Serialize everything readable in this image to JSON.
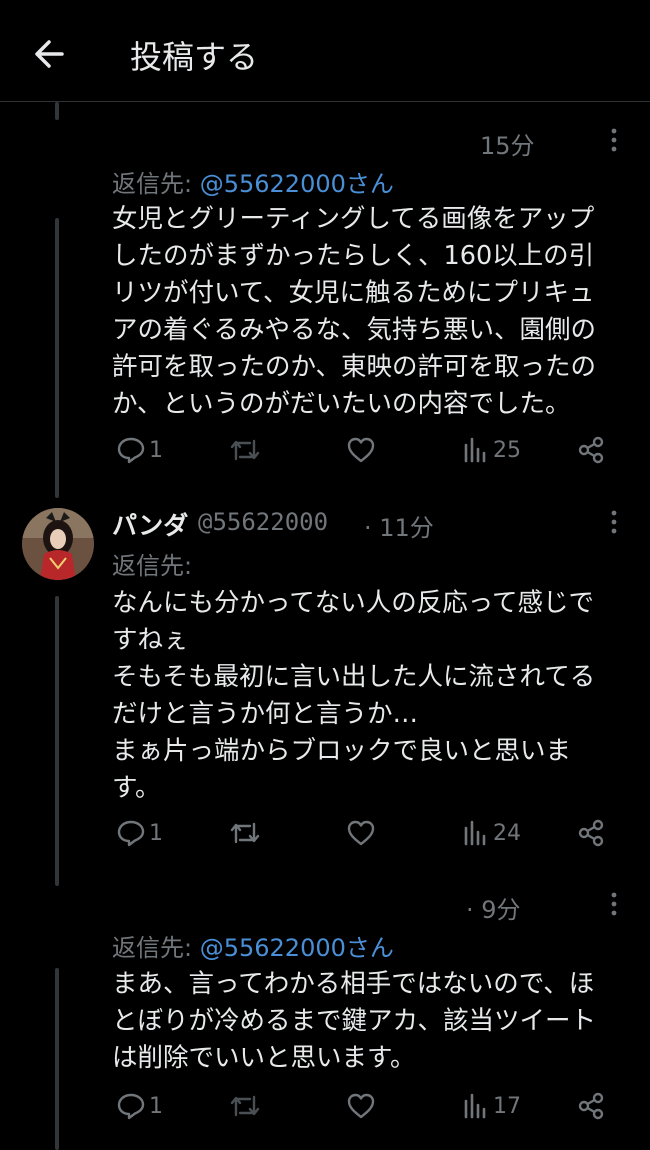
{
  "header": {
    "title": "投稿する"
  },
  "tweets": [
    {
      "time": "15分",
      "reply_prefix": "返信先: ",
      "reply_handle": "@55622000さん",
      "text": "女児とグリーティングしてる画像をアップ\nしたのがまずかったらしく、160以上の引\nリツが付いて、女児に触るためにプリキュ\nアの着ぐるみやるな、気持ち悪い、園側の\n許可を取ったのか、東映の許可を取ったの\nか、というのがだいたいの内容でした。",
      "replies": "1",
      "retweets": "",
      "likes": "",
      "views": "25"
    },
    {
      "name": "パンダ",
      "handle": "@55622000",
      "time": "· 11分",
      "reply_prefix": "返信先:",
      "text": "なんにも分かってない人の反応って感じで\nすねぇ\nそもそも最初に言い出した人に流されてる\nだけと言うか何と言うか…\nまぁ片っ端からブロックで良いと思いま\nす。",
      "replies": "1",
      "retweets": "",
      "likes": "",
      "views": "24"
    },
    {
      "time": "· 9分",
      "reply_prefix": "返信先: ",
      "reply_handle": "@55622000さん",
      "text": "まあ、言ってわかる相手ではないので、ほ\nとぼりが冷めるまで鍵アカ、該当ツイート\nは削除でいいと思います。",
      "replies": "1",
      "retweets": "",
      "likes": "",
      "views": "17"
    }
  ],
  "colors": {
    "accent": "#4a8fd6",
    "muted": "#71767b",
    "text": "#e7e9ea",
    "background": "#000000"
  },
  "icons": [
    "back-arrow-icon",
    "more-icon",
    "reply-icon",
    "retweet-icon",
    "like-icon",
    "views-icon",
    "share-icon"
  ]
}
